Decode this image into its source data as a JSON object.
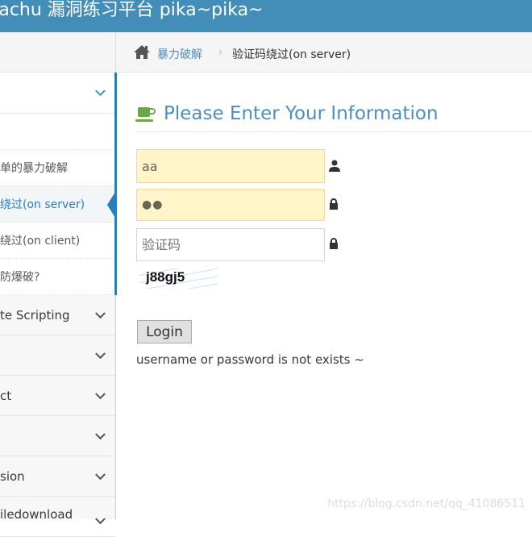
{
  "header": {
    "title": "kachu 漏洞练习平台 pika~pika~"
  },
  "breadcrumb": {
    "parent": "暴力破解",
    "current": "验证码绕过(on server)"
  },
  "sidebar": {
    "top_item": "",
    "sub_items": [
      {
        "label": ""
      },
      {
        "label": "单的暴力破解"
      },
      {
        "label": "绕过(on server)",
        "active": true
      },
      {
        "label": "绕过(on client)"
      },
      {
        "label": "防爆破?"
      }
    ],
    "items": [
      {
        "label": "te Scripting"
      },
      {
        "label": ""
      },
      {
        "label": "ct"
      },
      {
        "label": ""
      },
      {
        "label": "sion"
      },
      {
        "label": "iledownload"
      }
    ]
  },
  "form": {
    "title": "Please Enter Your Information",
    "username_value": "aa",
    "password_value": "●●",
    "captcha_placeholder": "验证码",
    "captcha_text": "j88gj5",
    "login_label": "Login",
    "message": "username or password is not exists ~"
  },
  "watermark": "https://blog.csdn.net/qq_41086511",
  "colors": {
    "header": "#438eb9",
    "accent": "#2b7dbc",
    "autofill": "#fff5c8",
    "cup": "#69aa46"
  }
}
